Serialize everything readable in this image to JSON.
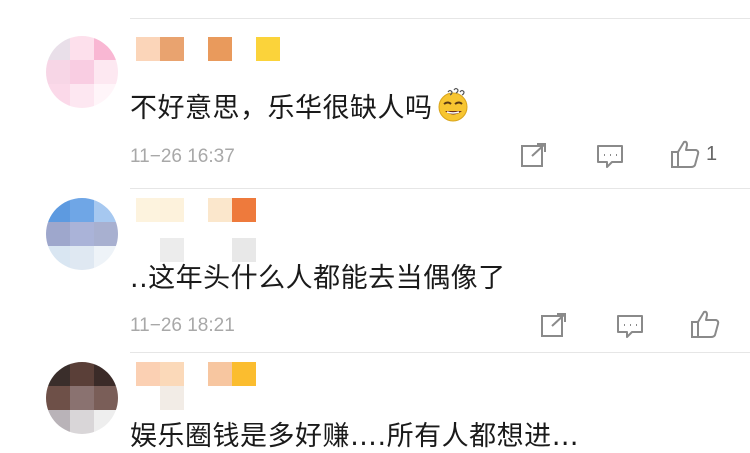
{
  "comments": [
    {
      "text": "不好意思，乐华很缺人吗",
      "emoji_icon": "dizzy-grin-emoji",
      "time": "11−26 16:37",
      "like_count": "1",
      "avatar_colors": [
        "#e9dfe9",
        "#fde0ec",
        "#f9b7d3",
        "#f7d6e6",
        "#f9cde2",
        "#fde8f1",
        "#fbd9e9",
        "#fde7f1",
        "#fff5f9"
      ],
      "name_colors": [
        "#fbd5b9",
        "#e9a36f",
        "#ffffff",
        "#e99a5c",
        "#ffffff",
        "#fbd33a"
      ]
    },
    {
      "text": "..这年头什么人都能去当偶像了",
      "time": "11−26 18:21",
      "avatar_colors": [
        "#5d9ae0",
        "#6fa6e6",
        "#a6c8f0",
        "#9ea7cc",
        "#aab3d8",
        "#a8b0d0",
        "#d9e6f2",
        "#dfe8f2",
        "#eef3f8"
      ],
      "name_colors": [
        "#fdf3de",
        "#fdf2dc",
        "#ffffff",
        "#fbe7cc",
        "#ee7a3c",
        "#ffffff"
      ],
      "name2_colors": [
        "#ececec",
        "#ffffff",
        "#ffffff",
        "#e8e8e8",
        "#ffffff",
        "#ffffff"
      ]
    },
    {
      "text": "娱乐圈钱是多好赚….所有人都想进…",
      "time": "",
      "avatar_colors": [
        "#3a2e2b",
        "#5a3f38",
        "#3b2b28",
        "#6e5048",
        "#8a7270",
        "#7a5e58",
        "#b9b3b8",
        "#d9d6d8",
        "#eeeeee"
      ],
      "name_colors": [
        "#fbd0b3",
        "#fbd9b9",
        "#ffffff",
        "#f7c6a0",
        "#fbbd2f",
        "#ffffff"
      ],
      "name2_colors": [
        "#f2ece6",
        "#ffffff",
        "#ffffff",
        "#ffffff",
        "#ffffff",
        "#ffffff"
      ]
    }
  ],
  "icons": {
    "share": "share-icon",
    "comment": "comment-icon",
    "like": "thumbs-up-icon"
  },
  "colors": {
    "time_text": "#a8a8a8",
    "icon_gray": "#8a8a8a",
    "separator": "#e6e6e6"
  }
}
